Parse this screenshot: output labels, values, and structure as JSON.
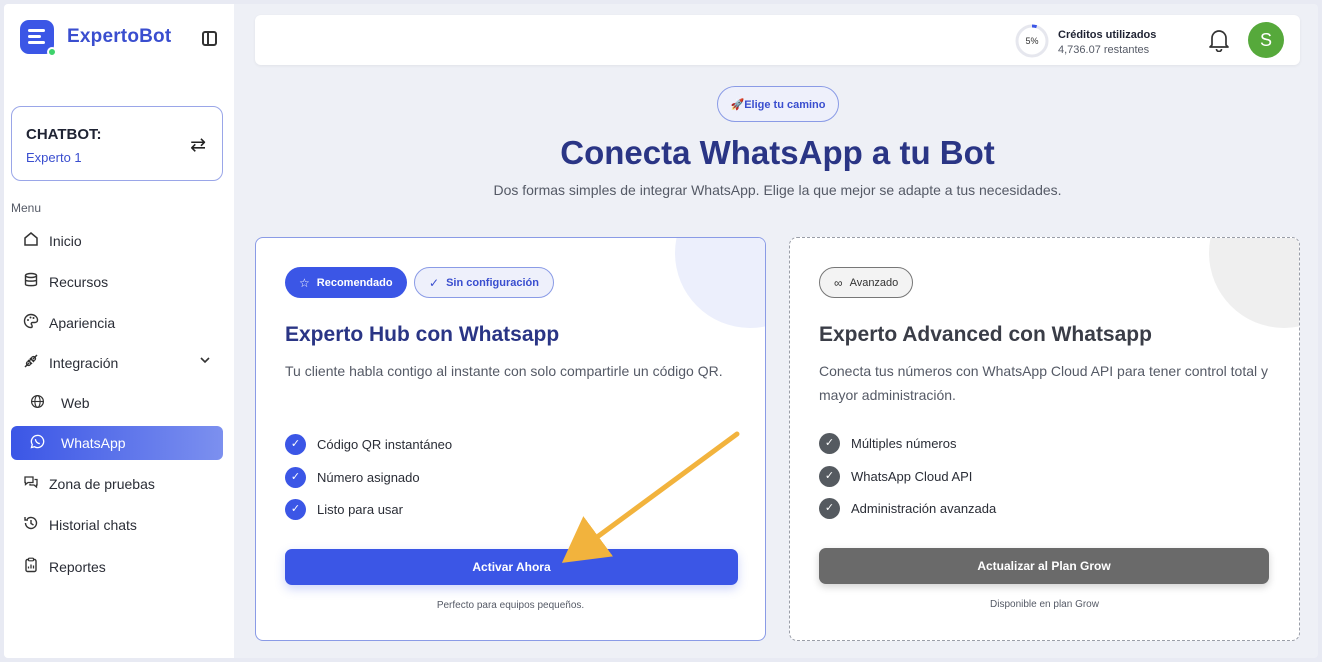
{
  "app": {
    "name": "ExpertoBot"
  },
  "chatbot": {
    "label": "CHATBOT:",
    "name": "Experto 1"
  },
  "sidebar": {
    "menu_label": "Menu",
    "items": [
      {
        "label": "Inicio",
        "icon": "home-icon"
      },
      {
        "label": "Recursos",
        "icon": "database-icon"
      },
      {
        "label": "Apariencia",
        "icon": "palette-icon"
      },
      {
        "label": "Integración",
        "icon": "plug-icon"
      },
      {
        "label": "Web",
        "icon": "globe-icon"
      },
      {
        "label": "WhatsApp",
        "icon": "whatsapp-icon",
        "active": true
      },
      {
        "label": "Zona de pruebas",
        "icon": "chat-bubbles-icon"
      },
      {
        "label": "Historial chats",
        "icon": "history-icon"
      },
      {
        "label": "Reportes",
        "icon": "clipboard-icon"
      }
    ]
  },
  "topbar": {
    "credits_percent": "5%",
    "credits_progress": 0.05,
    "credits_title": "Créditos utilizados",
    "credits_remaining": "4,736.07 restantes",
    "avatar_letter": "S"
  },
  "hero": {
    "pill": "🚀Elige tu camino",
    "title": "Conecta WhatsApp a tu Bot",
    "subtitle": "Dos formas simples de integrar WhatsApp. Elige la que mejor se adapte a tus necesidades."
  },
  "hub_card": {
    "badge_recommended": "Recomendado",
    "badge_noconfig": "Sin configuración",
    "title": "Experto Hub con Whatsapp",
    "description": "Tu cliente habla contigo al instante con solo compartirle un código QR.",
    "features": [
      "Código QR instantáneo",
      "Número asignado",
      "Listo para usar"
    ],
    "cta": "Activar Ahora",
    "note": "Perfecto para equipos pequeños."
  },
  "advanced_card": {
    "badge": "Avanzado",
    "title": "Experto Advanced con Whatsapp",
    "description": "Conecta tus números con WhatsApp Cloud API para tener control total y mayor administración.",
    "features": [
      "Múltiples números",
      "WhatsApp Cloud API",
      "Administración avanzada"
    ],
    "cta": "Actualizar al Plan Grow",
    "note": "Disponible en plan Grow"
  },
  "colors": {
    "accent": "#3b56e6",
    "title": "#2a3585",
    "avatar": "#56a93b",
    "arrow": "#f2b33d"
  }
}
